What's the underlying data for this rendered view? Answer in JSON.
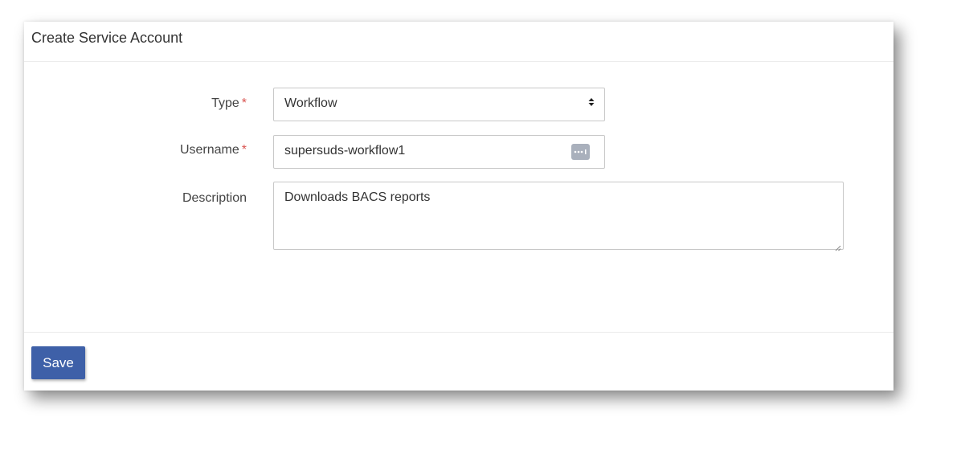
{
  "header": {
    "title": "Create Service Account"
  },
  "form": {
    "type": {
      "label": "Type",
      "required_marker": "*",
      "value": "Workflow"
    },
    "username": {
      "label": "Username",
      "required_marker": "*",
      "value": "supersuds-workflow1"
    },
    "description": {
      "label": "Description",
      "value": "Downloads BACS reports"
    }
  },
  "footer": {
    "save_label": "Save"
  },
  "colors": {
    "primary": "#3e60a8",
    "required": "#d9534f",
    "icon_badge": "#a9b0bc"
  },
  "icons": {
    "select": "sort-arrows-icon",
    "password_manager": "password-dots-icon",
    "resize": "resize-grip-icon"
  }
}
